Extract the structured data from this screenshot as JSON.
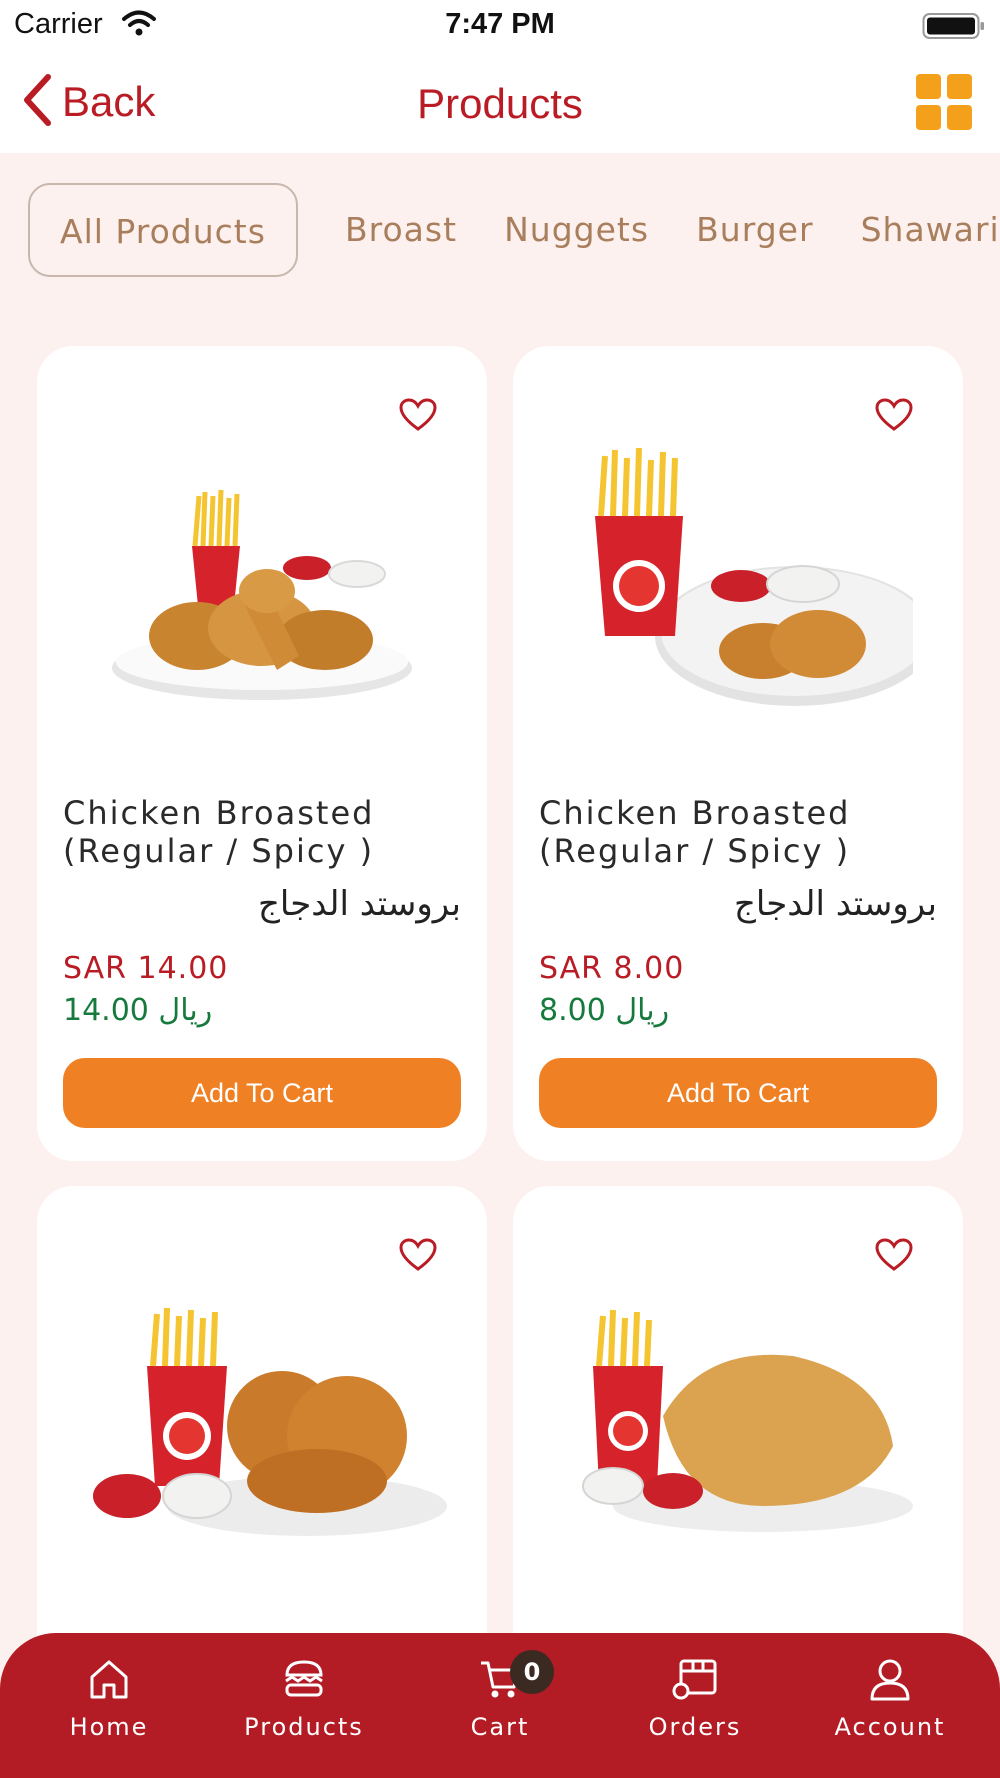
{
  "status_bar": {
    "carrier": "Carrier",
    "time": "7:47 PM"
  },
  "nav": {
    "back_label": "Back",
    "title": "Products",
    "grid_icon": "grid-icon"
  },
  "categories": [
    "All Products",
    "Broast",
    "Nuggets",
    "Burger",
    "Shawari"
  ],
  "products": [
    {
      "name_line1": "Chicken Broasted",
      "name_line2": "(Regular / Spicy )",
      "name_ar": "بروستد الدجاج",
      "price": "SAR 14.00",
      "price_ar": "14.00 ريال",
      "button": "Add To Cart"
    },
    {
      "name_line1": "Chicken Broasted",
      "name_line2": "(Regular / Spicy )",
      "name_ar": "بروستد الدجاج",
      "price": "SAR 8.00",
      "price_ar": "8.00 ريال",
      "button": "Add To Cart"
    }
  ],
  "tabs": {
    "home": "Home",
    "products": "Products",
    "cart": "Cart",
    "orders": "Orders",
    "account": "Account"
  },
  "cart_count": "0",
  "colors": {
    "brand_red": "#b31c24",
    "accent_orange": "#f08024",
    "price_green": "#177a3d",
    "background": "#fdf1ef"
  }
}
